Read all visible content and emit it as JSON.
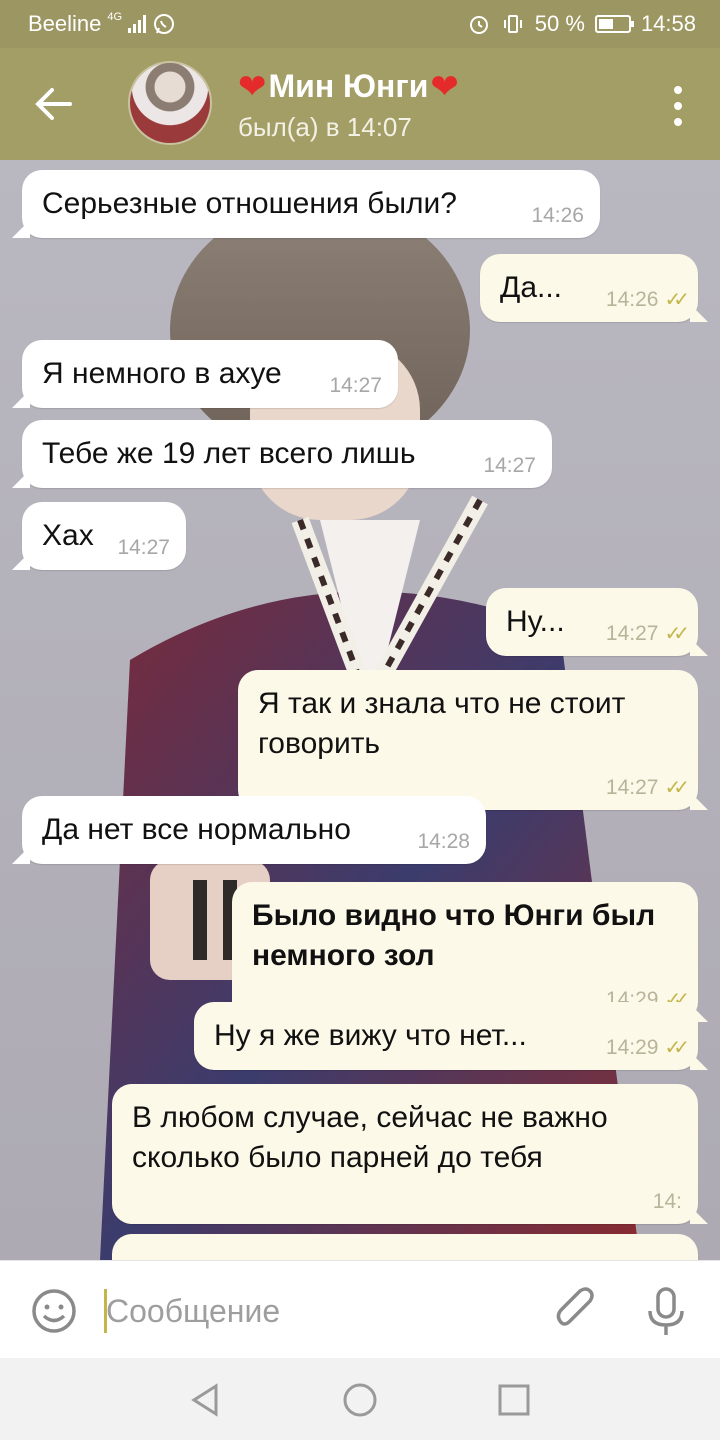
{
  "status_bar": {
    "carrier": "Beeline",
    "network": "4G",
    "battery_text": "50 %",
    "battery_level": 0.5,
    "time": "14:58",
    "icons": [
      "signal-icon",
      "whatsapp-icon",
      "alarm-icon",
      "vibrate-icon",
      "battery-icon"
    ]
  },
  "header": {
    "back_icon": "arrow-left-icon",
    "name": "Мин Юнги",
    "heart": "❤",
    "last_seen": "был(а) в 14:07",
    "menu_icon": "more-vert-icon"
  },
  "messages": [
    {
      "dir": "in",
      "text": "Серьезные отношения были?",
      "time": "14:26"
    },
    {
      "dir": "out",
      "text": "Да...",
      "time": "14:26",
      "read": true
    },
    {
      "dir": "in",
      "text": "Я немного в ахуе",
      "time": "14:27"
    },
    {
      "dir": "in",
      "text": "Тебе же 19 лет всего лишь",
      "time": "14:27"
    },
    {
      "dir": "in",
      "text": "Хах",
      "time": "14:27"
    },
    {
      "dir": "out",
      "text": "Ну...",
      "time": "14:27",
      "read": true
    },
    {
      "dir": "out",
      "text": "Я так и знала что не стоит говорить",
      "time": "14:27",
      "read": true
    },
    {
      "dir": "in",
      "text": "Да нет все нормально",
      "time": "14:28"
    },
    {
      "dir": "out",
      "text": "Было видно что Юнги был немного зол",
      "time": "14:29",
      "read": true,
      "bold": true
    },
    {
      "dir": "out",
      "text": "Ну я же вижу что нет...",
      "time": "14:29",
      "read": true
    },
    {
      "dir": "out",
      "text": "В любом случае, сейчас не важно сколько было парней до тебя",
      "time": "14:",
      "read": false
    }
  ],
  "input": {
    "placeholder": "Сообщение",
    "emoji_icon": "smiley-icon",
    "attach_icon": "paperclip-icon",
    "mic_icon": "microphone-icon"
  },
  "scroll_button_icon": "chevron-down-icon",
  "navbar": {
    "icons": [
      "back-triangle-icon",
      "home-circle-icon",
      "recents-square-icon"
    ]
  },
  "colors": {
    "header": "#a39d66",
    "status_bar": "#9c9663",
    "incoming_bubble": "#ffffff",
    "outgoing_bubble": "#fcf9e9",
    "read_check": "#c4b64a"
  }
}
